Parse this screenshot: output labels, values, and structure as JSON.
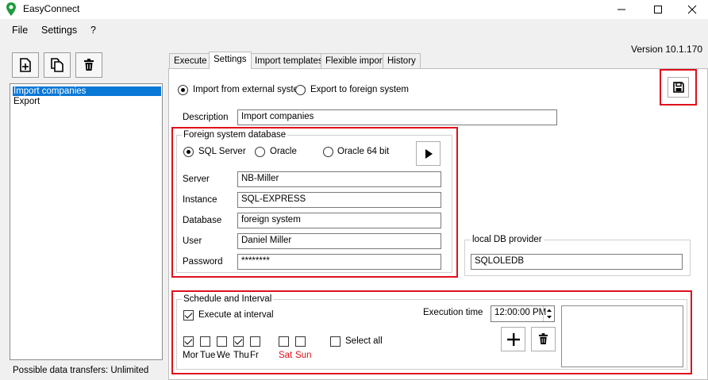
{
  "window": {
    "title": "EasyConnect",
    "minimize_icon": "minimize-icon",
    "maximize_icon": "maximize-icon",
    "close_icon": "close-icon"
  },
  "menu": {
    "file": "File",
    "settings": "Settings",
    "help": "?"
  },
  "version": "Version 10.1.170",
  "toolbar": {
    "new_icon": "add-document-icon",
    "copy_icon": "copy-document-icon",
    "delete_icon": "trash-icon"
  },
  "tree": {
    "items": [
      "Import companies",
      "Export"
    ],
    "selected": "Import companies"
  },
  "status": "Possible data transfers: Unlimited",
  "tabs": [
    "Execute",
    "Settings",
    "Import templates",
    "Flexible import",
    "History"
  ],
  "active_tab": "Settings",
  "direction": {
    "import_label": "Import from external system",
    "export_label": "Export to foreign system",
    "selected": "import"
  },
  "save_icon": "save-icon",
  "description": {
    "label": "Description",
    "value": "Import companies"
  },
  "foreign_db": {
    "legend": "Foreign system database",
    "types": [
      "SQL Server",
      "Oracle",
      "Oracle 64 bit"
    ],
    "selected": "SQL Server",
    "run_icon": "play-icon",
    "server_label": "Server",
    "server_value": "NB-Miller",
    "instance_label": "Instance",
    "instance_value": "SQL-EXPRESS",
    "database_label": "Database",
    "database_value": "foreign system",
    "user_label": "User",
    "user_value": "Daniel Miller",
    "password_label": "Password",
    "password_value": "********"
  },
  "local_db": {
    "legend": "local DB provider",
    "value": "SQLOLEDB"
  },
  "schedule": {
    "legend": "Schedule and Interval",
    "execute_interval_label": "Execute at interval",
    "execute_interval_checked": true,
    "execution_time_label": "Execution time",
    "execution_time_value": "12:00:00 PM",
    "days": [
      {
        "label": "Mor",
        "checked": true
      },
      {
        "label": "Tue",
        "checked": false
      },
      {
        "label": "We",
        "checked": false
      },
      {
        "label": "Thu",
        "checked": true
      },
      {
        "label": "Fr",
        "checked": false
      },
      {
        "label": "Sat",
        "checked": false
      },
      {
        "label": "Sun",
        "checked": false
      }
    ],
    "select_all_label": "Select all",
    "add_icon": "plus-icon",
    "delete_icon": "trash-icon",
    "accent_red": "#e0101b"
  }
}
